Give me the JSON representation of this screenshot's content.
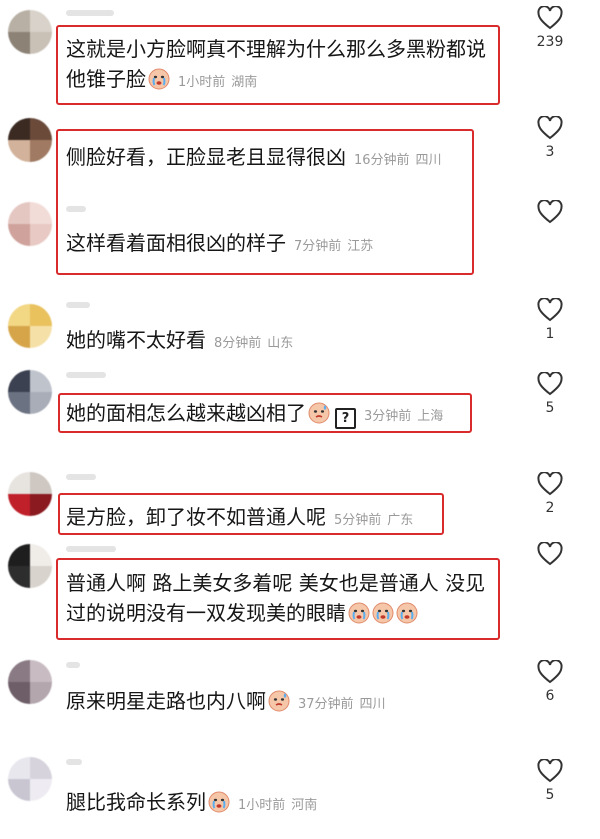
{
  "comments": [
    {
      "text": "这就是小方脸啊真不理解为什么那么多黑粉都说他锥子脸",
      "emoji": [
        "crying-face"
      ],
      "time": "1小时前",
      "location": "湖南",
      "likes": "239"
    },
    {
      "text": "侧脸好看，正脸显老且显得很凶",
      "emoji": [],
      "time": "16分钟前",
      "location": "四川",
      "likes": "3"
    },
    {
      "text": "这样看着面相很凶的样子",
      "emoji": [],
      "time": "7分钟前",
      "location": "江苏",
      "likes": ""
    },
    {
      "text": "她的嘴不太好看",
      "emoji": [],
      "time": "8分钟前",
      "location": "山东",
      "likes": "1"
    },
    {
      "text": "她的面相怎么越来越凶相了",
      "emoji": [
        "sweat-face"
      ],
      "qmark": "?",
      "time": "3分钟前",
      "location": "上海",
      "likes": "5"
    },
    {
      "text": "是方脸，卸了妆不如普通人呢",
      "emoji": [],
      "time": "5分钟前",
      "location": "广东",
      "likes": "2"
    },
    {
      "text": "普通人啊 路上美女多着呢 美女也是普通人 没见过的说明没有一双发现美的眼睛",
      "emoji": [
        "crying-face",
        "crying-face",
        "crying-face"
      ],
      "time": "",
      "location": "",
      "likes": ""
    },
    {
      "text": "原来明星走路也内八啊",
      "emoji": [
        "sweat-face"
      ],
      "time": "37分钟前",
      "location": "四川",
      "likes": "6"
    },
    {
      "text": "腿比我命长系列",
      "emoji": [
        "crying-face"
      ],
      "time": "1小时前",
      "location": "河南",
      "likes": "5"
    }
  ],
  "colors": {
    "highlight": "#d92b2b",
    "meta": "#9a9a9a",
    "text": "#161616"
  }
}
